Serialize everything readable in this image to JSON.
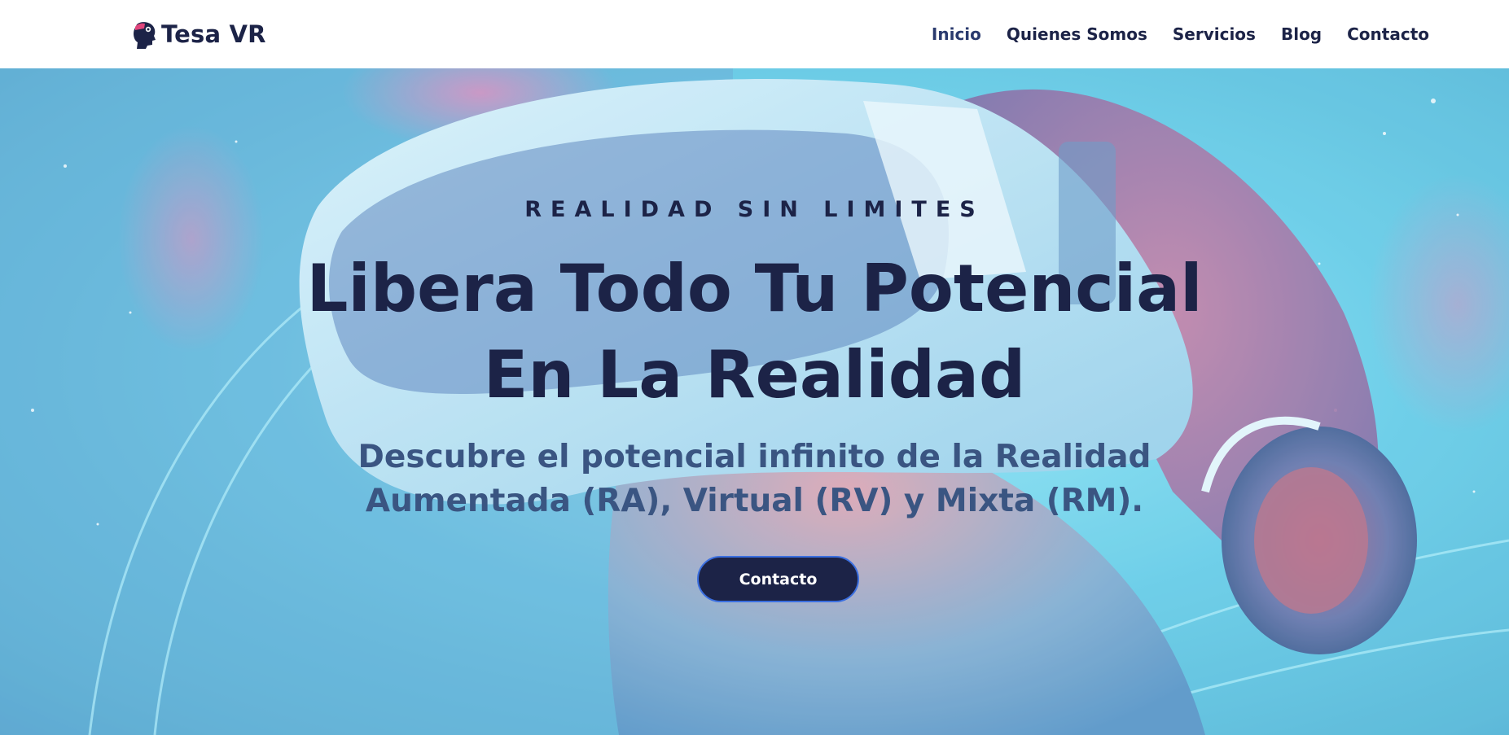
{
  "brand": {
    "name": "Tesa VR",
    "logo_icon": "vr-head-icon"
  },
  "nav": {
    "items": [
      {
        "label": "Inicio"
      },
      {
        "label": "Quienes Somos"
      },
      {
        "label": "Servicios"
      },
      {
        "label": "Blog"
      },
      {
        "label": "Contacto"
      }
    ]
  },
  "hero": {
    "eyebrow": "REALIDAD SIN LIMITES",
    "headline_line1": "Libera Todo Tu Potencial",
    "headline_line2": "En La Realidad",
    "subhead_line1": "Descubre el potencial infinito de la Realidad",
    "subhead_line2": "Aumentada (RA), Virtual (RV) y Mixta (RM).",
    "cta_label": "Contacto",
    "background_image": "person-wearing-vr-headset-in-space"
  },
  "colors": {
    "primary": "#1c2347",
    "subhead": "#3a5582",
    "cta_border": "#3b6fe0",
    "logo_accent": "#e0457b"
  }
}
